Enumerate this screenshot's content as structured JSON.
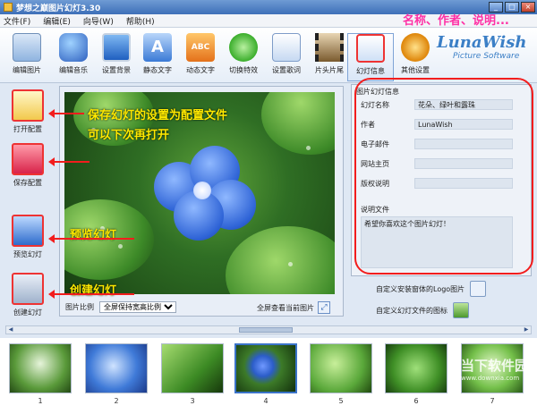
{
  "window": {
    "title": "梦想之巅图片幻灯3.30"
  },
  "menu": [
    "文件(F)",
    "编辑(E)",
    "向导(W)",
    "帮助(H)"
  ],
  "toolbar": [
    {
      "label": "编辑图片",
      "icon": "edit-picture-icon",
      "color": "#5b9bd5"
    },
    {
      "label": "编辑音乐",
      "icon": "music-icon",
      "color": "#3c6fc4"
    },
    {
      "label": "设置背景",
      "icon": "monitor-icon",
      "color": "#2a6fd1"
    },
    {
      "label": "静态文字",
      "icon": "static-text-icon",
      "color": "#4a86dc"
    },
    {
      "label": "动态文字",
      "icon": "dynamic-text-icon",
      "color": "#f08a1e"
    },
    {
      "label": "切换特效",
      "icon": "transition-icon",
      "color": "#4cbb3e"
    },
    {
      "label": "设置歌词",
      "icon": "lyrics-icon",
      "color": "#5a8fd8"
    },
    {
      "label": "片头片尾",
      "icon": "film-icon",
      "color": "#6a4a22"
    },
    {
      "label": "幻灯信息",
      "icon": "slideshow-info-icon",
      "color": "#3f7fd0",
      "selected": true
    },
    {
      "label": "其他设置",
      "icon": "gear-icon",
      "color": "#f0a020"
    }
  ],
  "brand": {
    "line1": "LunaWish",
    "line2": "Picture Software"
  },
  "left_buttons": [
    {
      "label": "打开配置",
      "icon": "open-config-icon"
    },
    {
      "label": "保存配置",
      "icon": "save-config-icon"
    },
    {
      "label": "预览幻灯",
      "icon": "preview-icon"
    },
    {
      "label": "创建幻灯",
      "icon": "create-icon"
    }
  ],
  "annotations": {
    "header": "名称、作者、说明...",
    "save_note_1": "保存幻灯的设置为配置文件",
    "save_note_2": "可以下次再打开",
    "preview_note": "预览幻灯",
    "create_note": "创建幻灯"
  },
  "preview": {
    "ratio_label": "图片比例",
    "ratio_value": "全屏保持宽高比例",
    "fullscreen_label": "全屏查看当前图片"
  },
  "info": {
    "group_label": "图片幻灯信息",
    "fields": [
      {
        "label": "幻灯名称",
        "value": "花朵、绿叶和露珠"
      },
      {
        "label": "作者",
        "value": "LunaWish"
      },
      {
        "label": "电子邮件",
        "value": ""
      },
      {
        "label": "网站主页",
        "value": ""
      },
      {
        "label": "版权说明",
        "value": ""
      }
    ],
    "desc_label": "说明文件",
    "desc_value": "希望你喜欢这个图片幻灯！",
    "logo_label": "自定义安装窗体的Logo图片",
    "icon_label": "自定义幻灯文件的图标"
  },
  "thumbnails": [
    "1",
    "2",
    "3",
    "4",
    "5",
    "6",
    "7"
  ],
  "watermark": {
    "main": "当下软件园",
    "sub": "www.downxia.com"
  }
}
